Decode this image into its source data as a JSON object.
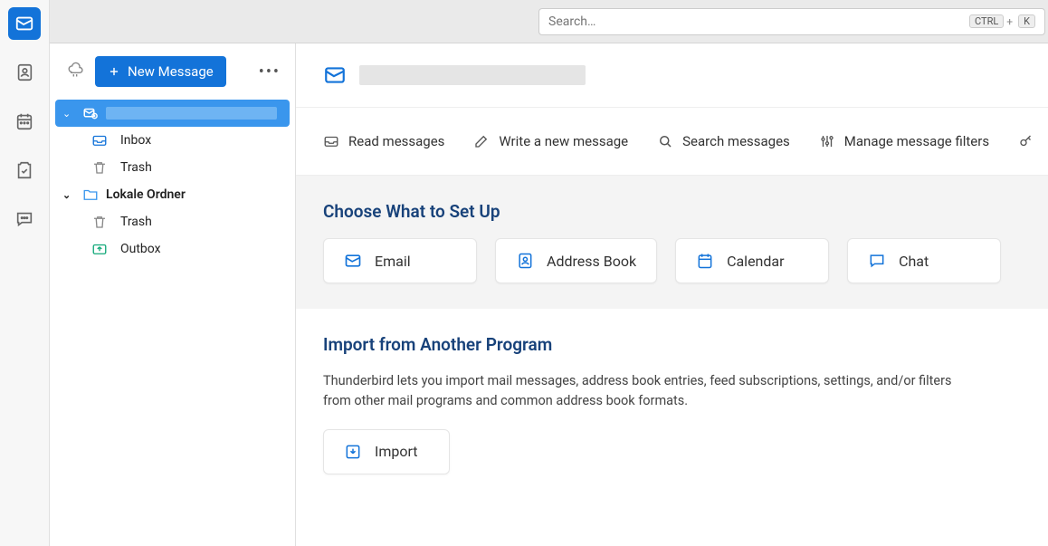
{
  "search": {
    "placeholder": "Search…",
    "kbd1": "CTRL",
    "kbd_plus": "+",
    "kbd2": "K"
  },
  "new_message_label": "New Message",
  "folders": {
    "inbox": "Inbox",
    "trash": "Trash",
    "local_label": "Lokale Ordner",
    "local_trash": "Trash",
    "outbox": "Outbox"
  },
  "actions": {
    "read": "Read messages",
    "write": "Write a new message",
    "search": "Search messages",
    "filters": "Manage message filters"
  },
  "setup": {
    "heading": "Choose What to Set Up",
    "email": "Email",
    "address_book": "Address Book",
    "calendar": "Calendar",
    "chat": "Chat"
  },
  "import": {
    "heading": "Import from Another Program",
    "description": "Thunderbird lets you import mail messages, address book entries, feed subscriptions, settings, and/or filters from other mail programs and common address book formats.",
    "button": "Import"
  }
}
